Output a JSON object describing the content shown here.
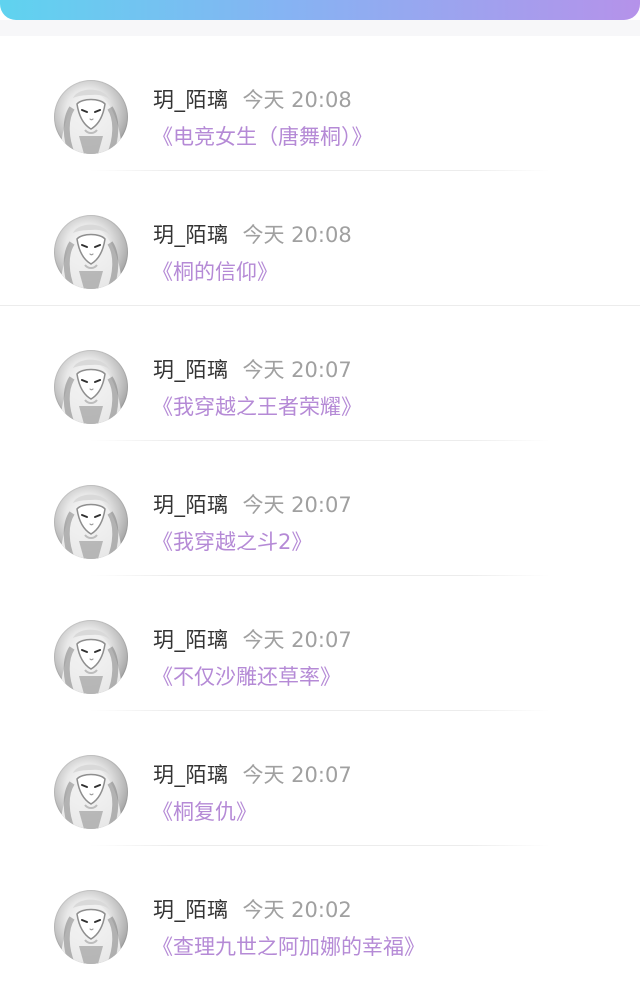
{
  "header": {
    "accent_gradient": [
      "#5fd3ef",
      "#86b3f3",
      "#b592ea"
    ]
  },
  "feed": {
    "items": [
      {
        "username": "玥_陌璃",
        "time": "今天 20:08",
        "title": "《电竞女生（唐舞桐）》",
        "avatar_icon": "anime-avatar-icon"
      },
      {
        "username": "玥_陌璃",
        "time": "今天 20:08",
        "title": "《桐的信仰》",
        "avatar_icon": "anime-avatar-icon"
      },
      {
        "username": "玥_陌璃",
        "time": "今天 20:07",
        "title": "《我穿越之王者荣耀》",
        "avatar_icon": "anime-avatar-icon"
      },
      {
        "username": "玥_陌璃",
        "time": "今天 20:07",
        "title": "《我穿越之斗2》",
        "avatar_icon": "anime-avatar-icon"
      },
      {
        "username": "玥_陌璃",
        "time": "今天 20:07",
        "title": "《不仅沙雕还草率》",
        "avatar_icon": "anime-avatar-icon"
      },
      {
        "username": "玥_陌璃",
        "time": "今天 20:07",
        "title": "《桐复仇》",
        "avatar_icon": "anime-avatar-icon"
      },
      {
        "username": "玥_陌璃",
        "time": "今天 20:02",
        "title": "《查理九世之阿加娜的幸福》",
        "avatar_icon": "anime-avatar-icon"
      }
    ]
  },
  "colors": {
    "username": "#333333",
    "time": "#a0a0a0",
    "title": "#b58ad6",
    "divider": "#ececec"
  }
}
